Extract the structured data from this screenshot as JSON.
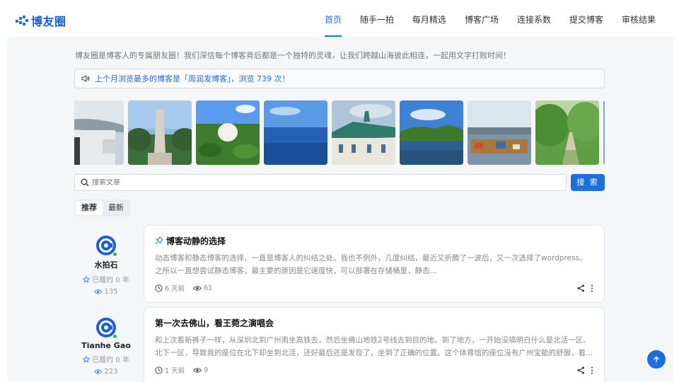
{
  "site": {
    "logo_text": "博友圈"
  },
  "nav": [
    {
      "label": "首页",
      "active": true
    },
    {
      "label": "随手一拍"
    },
    {
      "label": "每月精选"
    },
    {
      "label": "博客广场"
    },
    {
      "label": "连接系数"
    },
    {
      "label": "提交博客"
    },
    {
      "label": "审核结果"
    }
  ],
  "intro": "博友圈是博客人的专属朋友圈！我们深信每个博客背后都是一个独特的灵魂，让我们跨越山海彼此相连，一起用文字打败时间！",
  "notice": {
    "text": "上个月浏览最多的博客是「周润发博客」，浏览 739 次！"
  },
  "gallery": [
    {
      "icon": "photo-building-sky"
    },
    {
      "icon": "photo-monument"
    },
    {
      "icon": "photo-lotus-pond"
    },
    {
      "icon": "photo-sea"
    },
    {
      "icon": "photo-green-roof-building"
    },
    {
      "icon": "photo-lake-hills"
    },
    {
      "icon": "photo-harbor"
    },
    {
      "icon": "photo-tree-path"
    }
  ],
  "search": {
    "placeholder": "搜索文章",
    "button_label": "搜 索"
  },
  "tabs": [
    {
      "label": "推荐",
      "active": true
    },
    {
      "label": "最新"
    }
  ],
  "posts": [
    {
      "author": {
        "name": "水拍石",
        "status": "已履约 0 年",
        "views": "135"
      },
      "title": "博客动静的选择",
      "pinned": true,
      "excerpt": "动态博客和静态博客的选择，一直是博客人的纠结之处。我也不例外，几度纠结，最近又折腾了一波后，又一次选择了wordpress。之所以一直想尝试静态博客，最主要的原因是它速度快，可以部署在存储桶里，静态...",
      "time": "6 天前",
      "views": "61"
    },
    {
      "author": {
        "name": "Tianhe Gao",
        "status": "已履约 0 年",
        "views": "223"
      },
      "title": "第一次去佛山，看王菀之演唱会",
      "pinned": false,
      "excerpt": "和上次看新裤子一样，从深圳北到广州南坐高铁去，然后坐佛山地铁2号线去到目的地。到了地方，一开始没搞明白什么是北活一区、北下一区，导致我的座位在北下却坐到北活，还好最后还是发现了，坐到了正确的位置。这个体育馆的座位没有广州宝能的舒服，看...",
      "time": "1 天前",
      "views": "9"
    }
  ],
  "colors": {
    "accent": "#1d6fe0",
    "online": "#22bb55"
  }
}
